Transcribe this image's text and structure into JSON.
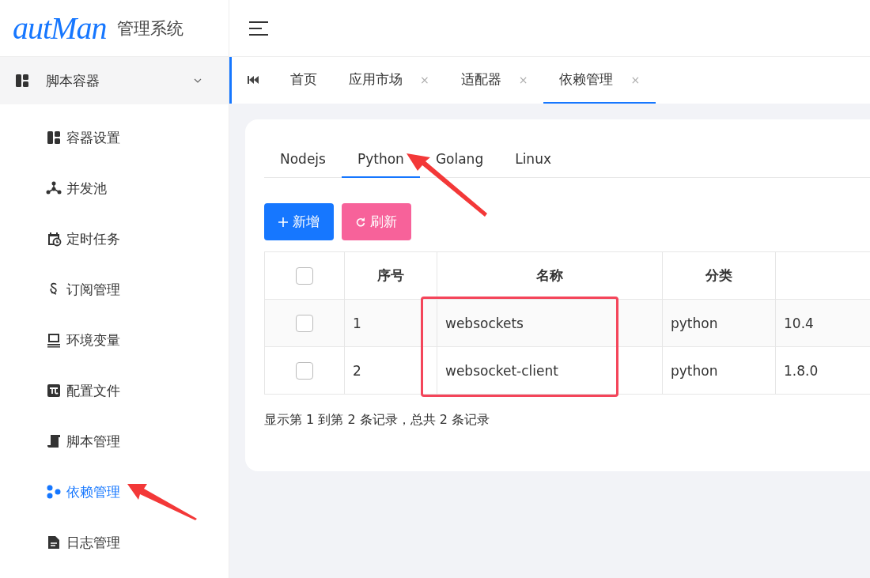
{
  "logo": {
    "brand": "autMan",
    "subtitle": "管理系统"
  },
  "sidebar": {
    "group": {
      "label": "脚本容器",
      "expanded": true
    },
    "items": [
      {
        "label": "容器设置",
        "selected": false
      },
      {
        "label": "并发池",
        "selected": false
      },
      {
        "label": "定时任务",
        "selected": false
      },
      {
        "label": "订阅管理",
        "selected": false
      },
      {
        "label": "环境变量",
        "selected": false
      },
      {
        "label": "配置文件",
        "selected": false
      },
      {
        "label": "脚本管理",
        "selected": false
      },
      {
        "label": "依赖管理",
        "selected": true
      },
      {
        "label": "日志管理",
        "selected": false
      }
    ]
  },
  "page_tabs": [
    {
      "label": "首页",
      "closable": false,
      "selected": false
    },
    {
      "label": "应用市场",
      "closable": true,
      "selected": false
    },
    {
      "label": "适配器",
      "closable": true,
      "selected": false
    },
    {
      "label": "依赖管理",
      "closable": true,
      "selected": true
    }
  ],
  "close_glyph": "×",
  "lang_tabs": [
    {
      "label": "Nodejs",
      "selected": false
    },
    {
      "label": "Python",
      "selected": true
    },
    {
      "label": "Golang",
      "selected": false
    },
    {
      "label": "Linux",
      "selected": false
    }
  ],
  "buttons": [
    {
      "label": "新增",
      "kind": "add"
    },
    {
      "label": "刷新",
      "kind": "refresh"
    }
  ],
  "table": {
    "all_checked": false,
    "columns": [
      "序号",
      "名称",
      "分类"
    ],
    "rows": [
      {
        "checked": false,
        "cells": [
          "1",
          "websockets",
          "python",
          "10.4"
        ]
      },
      {
        "checked": false,
        "cells": [
          "2",
          "websocket-client",
          "python",
          "1.8.0"
        ]
      }
    ]
  },
  "footer": "显示第 1 到第 2 条记录，总共 2 条记录"
}
